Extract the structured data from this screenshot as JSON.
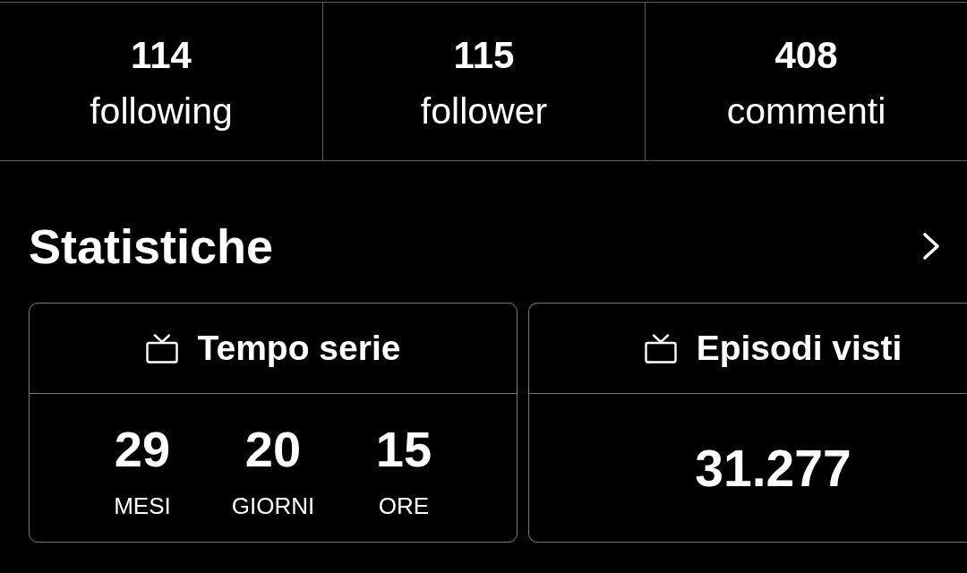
{
  "counts": [
    {
      "value": "114",
      "label": "following"
    },
    {
      "value": "115",
      "label": "follower"
    },
    {
      "value": "408",
      "label": "commenti"
    }
  ],
  "stats_section": {
    "title": "Statistiche"
  },
  "cards": [
    {
      "kind": "breakdown",
      "title": "Tempo serie",
      "parts": [
        {
          "value": "29",
          "unit": "MESI"
        },
        {
          "value": "20",
          "unit": "GIORNI"
        },
        {
          "value": "15",
          "unit": "ORE"
        }
      ]
    },
    {
      "kind": "single",
      "title": "Episodi visti",
      "value": "31.277"
    }
  ]
}
